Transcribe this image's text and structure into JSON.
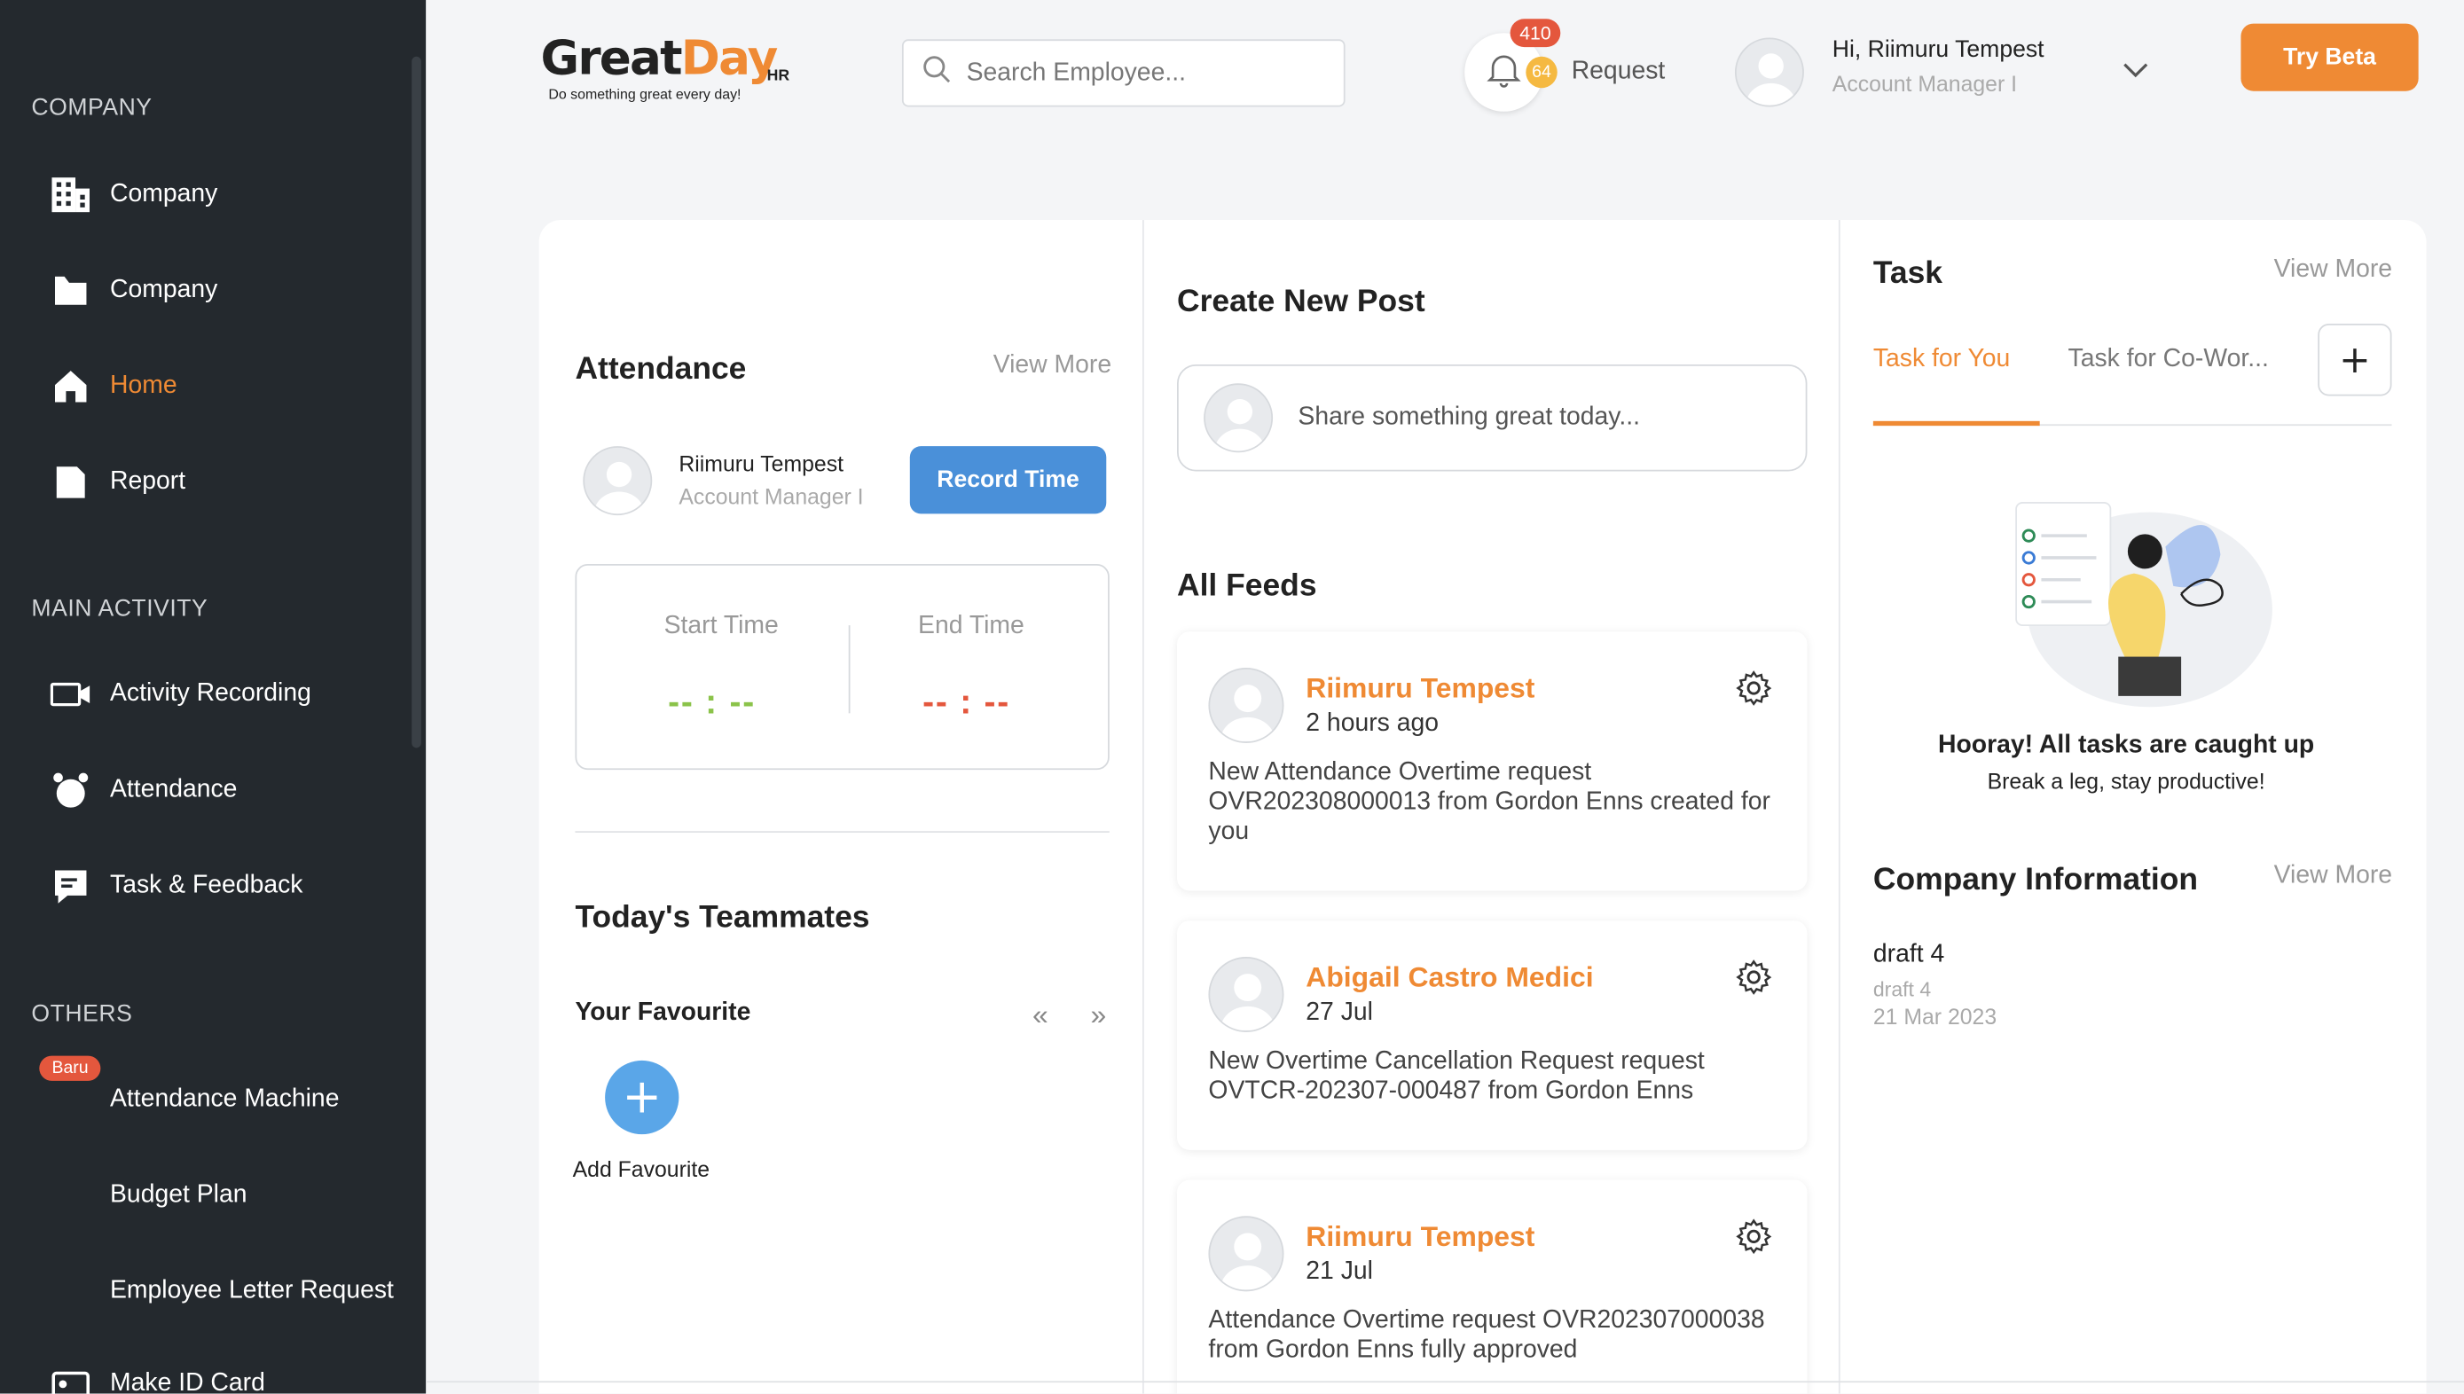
{
  "sidebar": {
    "sections": {
      "company": "COMPANY",
      "main_activity": "MAIN ACTIVITY",
      "others": "OTHERS"
    },
    "company_items": [
      {
        "label": "Company",
        "icon": "building-icon"
      },
      {
        "label": "Company",
        "icon": "folder-icon"
      },
      {
        "label": "Home",
        "icon": "home-icon",
        "active": true
      },
      {
        "label": "Report",
        "icon": "document-icon"
      }
    ],
    "main_items": [
      {
        "label": "Activity Recording",
        "icon": "video-camera-icon"
      },
      {
        "label": "Attendance",
        "icon": "alarm-clock-icon"
      },
      {
        "label": "Task & Feedback",
        "icon": "task-feedback-icon"
      }
    ],
    "other_items": [
      {
        "label": "Attendance Machine",
        "badge": "Baru"
      },
      {
        "label": "Budget Plan"
      },
      {
        "label": "Employee Letter Request"
      },
      {
        "label": "Make ID Card",
        "icon": "id-card-icon"
      }
    ]
  },
  "header": {
    "logo": {
      "text": "GreatDay",
      "suffix": "HR",
      "tagline": "Do something great every day!"
    },
    "search_placeholder": "Search Employee...",
    "notifications": {
      "count": "410",
      "request_count": "64",
      "label": "Request"
    },
    "user": {
      "greeting": "Hi, Riimuru Tempest",
      "role": "Account Manager I"
    },
    "try_beta": "Try Beta"
  },
  "attendance": {
    "title": "Attendance",
    "view_more": "View More",
    "user_name": "Riimuru Tempest",
    "user_role": "Account Manager I",
    "record_button": "Record Time",
    "start_label": "Start Time",
    "start_value": "-- : --",
    "end_label": "End Time",
    "end_value": "-- : --",
    "start_color": "#8bc34a",
    "end_color": "#e4573d"
  },
  "teammates": {
    "title": "Today's Teammates",
    "favourite_label": "Your Favourite",
    "add_label": "Add Favourite"
  },
  "feed": {
    "create_title": "Create New Post",
    "post_placeholder": "Share something great today...",
    "all_feeds_title": "All Feeds",
    "items": [
      {
        "name": "Riimuru Tempest",
        "time": "2 hours ago",
        "body": "New Attendance Overtime request OVR202308000013 from Gordon Enns created for you"
      },
      {
        "name": "Abigail Castro Medici",
        "time": "27 Jul",
        "body": "New Overtime Cancellation Request request OVTCR-202307-000487 from Gordon Enns"
      },
      {
        "name": "Riimuru Tempest",
        "time": "21 Jul",
        "body": "Attendance Overtime request OVR202307000038 from Gordon Enns fully approved"
      }
    ]
  },
  "task": {
    "title": "Task",
    "view_more": "View More",
    "tab_you": "Task for You",
    "tab_coworker": "Task for Co-Wor...",
    "add_button": "+",
    "empty_title": "Hooray! All tasks are caught up",
    "empty_sub": "Break a leg, stay productive!"
  },
  "company_info": {
    "title": "Company Information",
    "view_more": "View More",
    "item_title": "draft 4",
    "item_sub": "draft 4",
    "item_date": "21 Mar 2023"
  },
  "colors": {
    "accent": "#ef8a34",
    "primary_blue": "#4a90d9",
    "sidebar_bg": "#24292e"
  }
}
